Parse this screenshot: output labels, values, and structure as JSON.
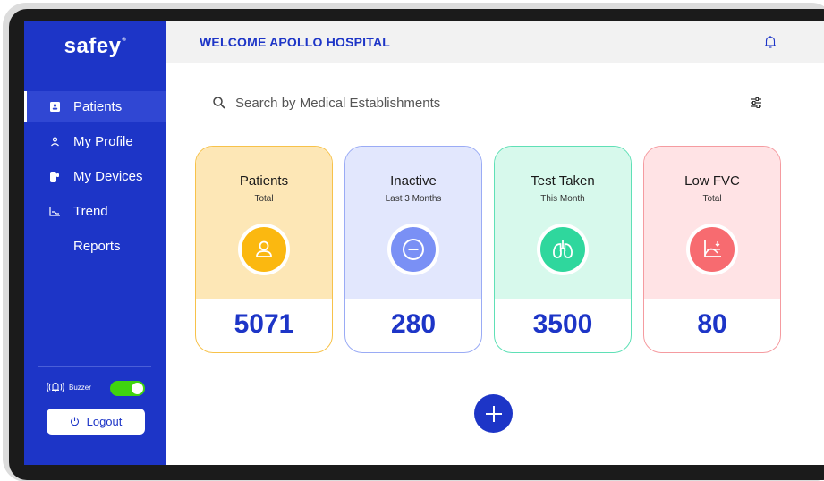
{
  "app": {
    "logo_text": "safey",
    "logo_mark": "®"
  },
  "header": {
    "welcome": "WELCOME APOLLO HOSPITAL",
    "bell_icon": "bell-icon"
  },
  "sidebar": {
    "items": [
      {
        "label": "Patients",
        "icon": "patient-card-icon",
        "active": true
      },
      {
        "label": "My Profile",
        "icon": "person-icon",
        "active": false
      },
      {
        "label": "My Devices",
        "icon": "device-icon",
        "active": false
      },
      {
        "label": "Trend",
        "icon": "chart-icon",
        "active": false
      },
      {
        "label": "Reports",
        "icon": "",
        "active": false
      }
    ],
    "buzzer_label": "Buzzer",
    "buzzer_on": true,
    "logout_label": "Logout"
  },
  "search": {
    "placeholder": "Search by Medical Establishments",
    "value": ""
  },
  "cards": [
    {
      "title": "Patients",
      "subtitle": "Total",
      "value": "5071",
      "icon": "person-icon",
      "bg": "#fde7b6",
      "border": "#f7c24a",
      "accent": "#fbb810"
    },
    {
      "title": "Inactive",
      "subtitle": "Last 3 Months",
      "value": "280",
      "icon": "minus-circle-icon",
      "bg": "#e2e7fd",
      "border": "#9aabf5",
      "accent": "#7a90f5"
    },
    {
      "title": "Test Taken",
      "subtitle": "This Month",
      "value": "3500",
      "icon": "lungs-icon",
      "bg": "#d7f9ec",
      "border": "#5fe0b6",
      "accent": "#2fd79d"
    },
    {
      "title": "Low FVC",
      "subtitle": "Total",
      "value": "80",
      "icon": "graph-down-icon",
      "bg": "#ffe3e5",
      "border": "#f59ba0",
      "accent": "#f76b70"
    }
  ],
  "colors": {
    "primary": "#1d35c7",
    "toggle_on": "#3fd40f"
  }
}
